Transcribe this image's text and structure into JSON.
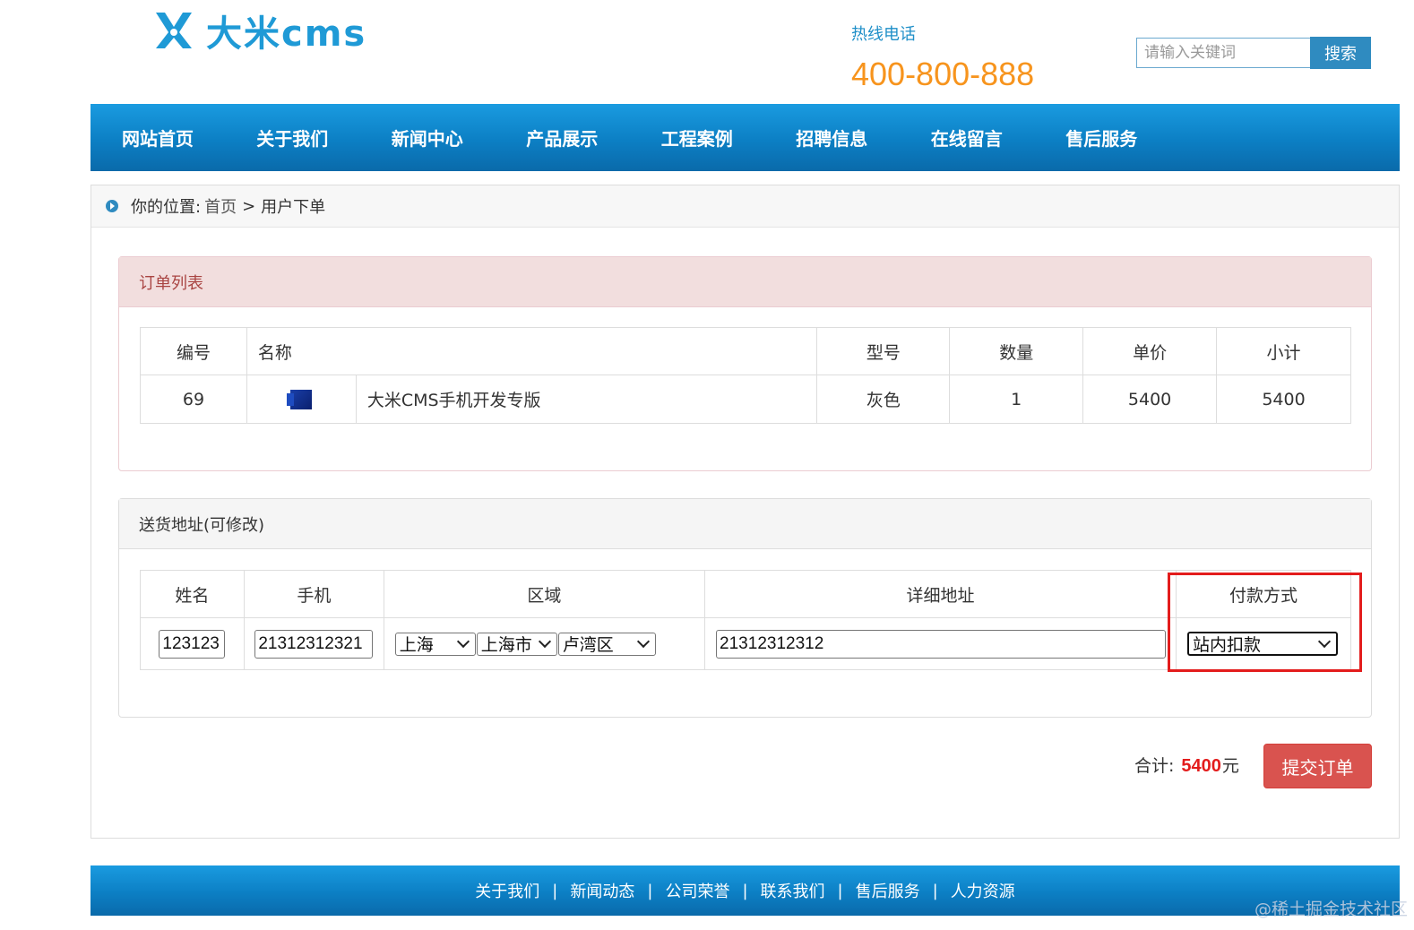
{
  "header": {
    "logo_text": "大米cms",
    "hotline_label": "热线电话",
    "hotline_number": "400-800-888",
    "search_placeholder": "请输入关键词",
    "search_button": "搜索"
  },
  "nav": {
    "items": [
      "网站首页",
      "关于我们",
      "新闻中心",
      "产品展示",
      "工程案例",
      "招聘信息",
      "在线留言",
      "售后服务"
    ]
  },
  "breadcrumb": {
    "prefix": "你的位置:",
    "home": "首页",
    "separator": ">",
    "current": "用户下单"
  },
  "order_panel": {
    "title": "订单列表",
    "columns": [
      "编号",
      "名称",
      "型号",
      "数量",
      "单价",
      "小计"
    ],
    "rows": [
      {
        "id": "69",
        "name": "大米CMS手机开发专版",
        "model": "灰色",
        "qty": "1",
        "price": "5400",
        "subtotal": "5400"
      }
    ]
  },
  "address_panel": {
    "title": "送货地址(可修改)",
    "columns": [
      "姓名",
      "手机",
      "区域",
      "详细地址",
      "付款方式"
    ],
    "name_value": "123123",
    "phone_value": "21312312321",
    "province": "上海",
    "city": "上海市",
    "district": "卢湾区",
    "address_value": "21312312312",
    "payment": "站内扣款"
  },
  "summary": {
    "label": "合计:",
    "amount": "5400",
    "unit": "元",
    "submit": "提交订单"
  },
  "footer": {
    "links": [
      "关于我们",
      "新闻动态",
      "公司荣誉",
      "联系我们",
      "售后服务",
      "人力资源"
    ],
    "separator": "|"
  },
  "watermark": "@稀土掘金技术社区",
  "colors": {
    "brand_blue": "#1a9be0",
    "hotline_orange": "#f7941d",
    "danger_red": "#d9534f",
    "highlight_red": "#e31c1c"
  }
}
